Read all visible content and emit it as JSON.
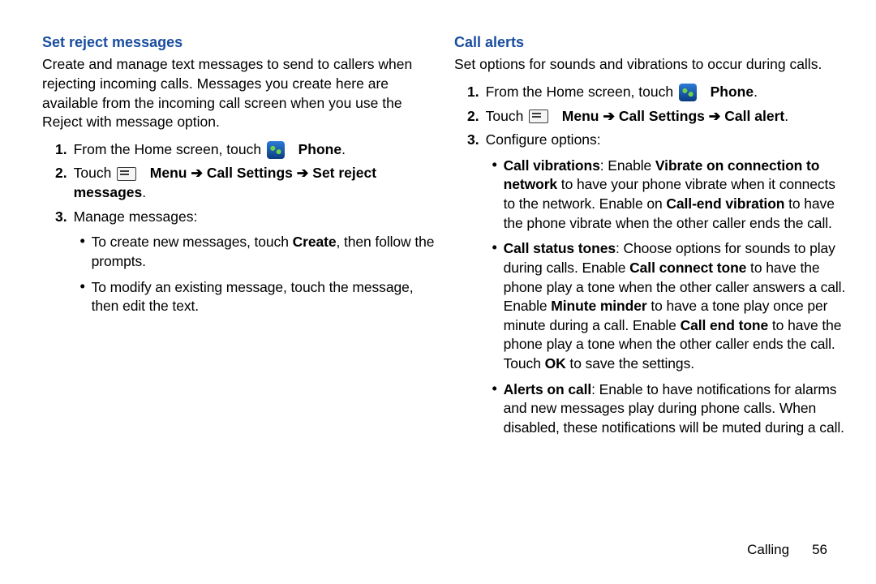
{
  "left": {
    "heading": "Set reject messages",
    "intro": "Create and manage text messages to send to callers when rejecting incoming calls. Messages you create here are available from the incoming call screen when you use the Reject with message option.",
    "steps": [
      {
        "num": "1.",
        "pre": "From the Home screen, touch ",
        "bold1": "Phone",
        "post": "."
      },
      {
        "num": "2.",
        "pre": "Touch ",
        "menu": "Menu",
        "arrow1": " ➔ ",
        "path1": "Call Settings",
        "arrow2": " ➔ ",
        "path2": "Set reject messages",
        "post": "."
      },
      {
        "num": "3.",
        "text": "Manage messages:",
        "bullets": [
          {
            "pre": "To create new messages, touch ",
            "b1": "Create",
            "post": ", then follow the prompts."
          },
          {
            "pre": "To modify an existing message, touch the message, then edit the text."
          }
        ]
      }
    ]
  },
  "right": {
    "heading": "Call alerts",
    "intro": "Set options for sounds and vibrations to occur during calls.",
    "steps": [
      {
        "num": "1.",
        "pre": "From the Home screen, touch ",
        "bold1": "Phone",
        "post": "."
      },
      {
        "num": "2.",
        "pre": "Touch ",
        "menu": "Menu",
        "arrow1": " ➔ ",
        "path1": "Call Settings",
        "arrow2": " ➔ ",
        "path2": "Call alert",
        "post": "."
      },
      {
        "num": "3.",
        "text": "Configure options:",
        "bullets": [
          {
            "b1": "Call vibrations",
            "t1": ": Enable ",
            "b2": "Vibrate on connection to network",
            "t2": " to have your phone vibrate when it connects to the network. Enable on ",
            "b3": "Call-end vibration",
            "t3": " to have the phone vibrate when the other caller ends the call."
          },
          {
            "b1": "Call status tones",
            "t1": ": Choose options for sounds to play during calls. Enable ",
            "b2": "Call connect tone",
            "t2": " to have the phone play a tone when the other caller answers a call. Enable ",
            "b3": "Minute minder",
            "t3": " to have a tone play once per minute during a call. Enable ",
            "b4": "Call end tone",
            "t4": " to have the phone play a tone when the other caller ends the call. Touch ",
            "b5": "OK",
            "t5": " to save the settings."
          },
          {
            "b1": "Alerts on call",
            "t1": ": Enable to have notifications for alarms and new messages play during phone calls. When disabled, these notifications will be muted during a call."
          }
        ]
      }
    ]
  },
  "footer": {
    "section": "Calling",
    "page": "56"
  }
}
